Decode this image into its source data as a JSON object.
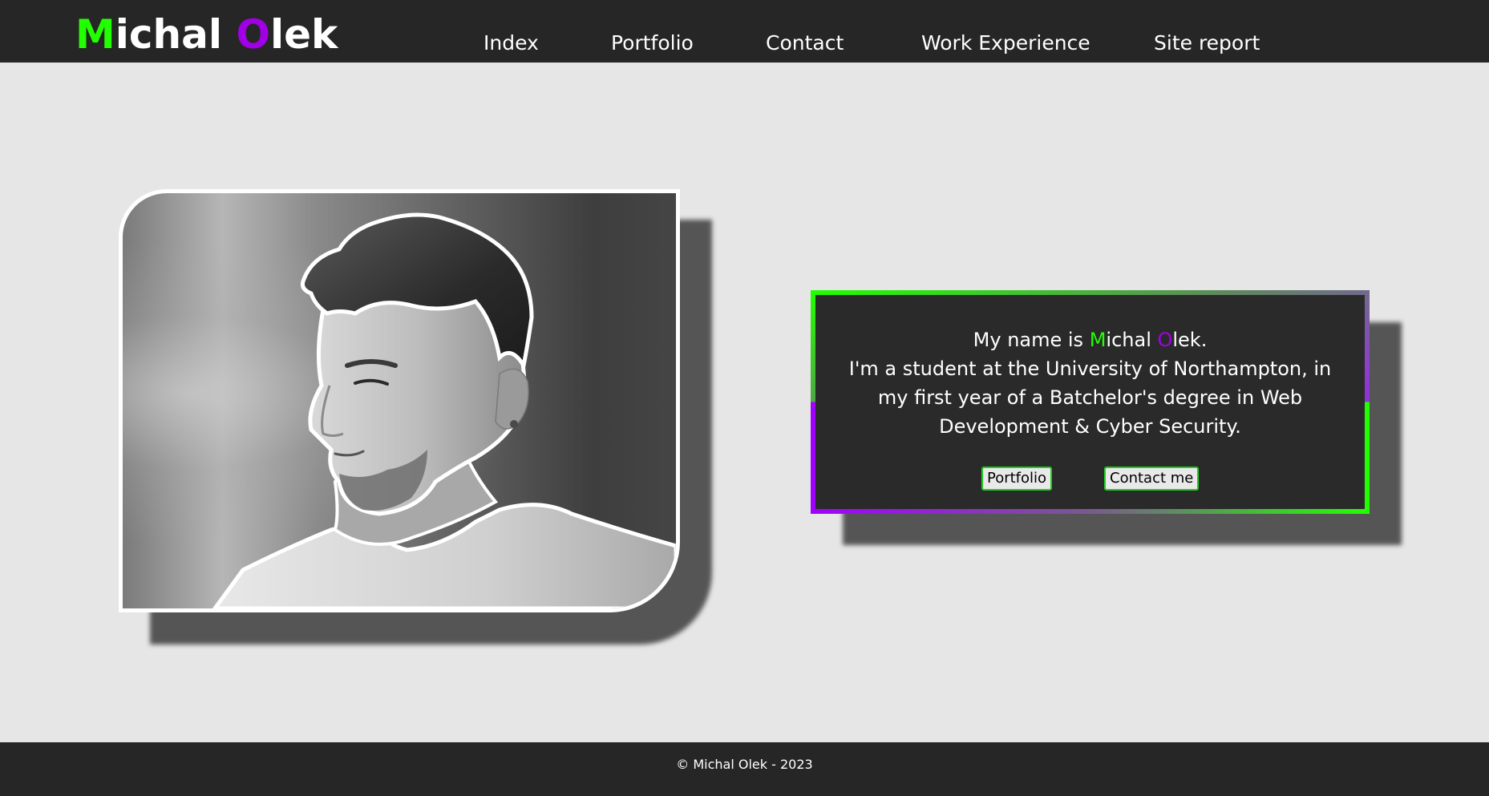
{
  "header": {
    "logo": {
      "first_initial": "M",
      "first_rest": "ichal ",
      "last_initial": "O",
      "last_rest": "lek"
    },
    "nav": [
      {
        "label": "Index"
      },
      {
        "label": "Portfolio"
      },
      {
        "label": "Contact"
      },
      {
        "label": "Work Experience"
      },
      {
        "label": "Site report"
      }
    ]
  },
  "intro": {
    "line1_prefix": "My name is ",
    "name_first_initial": "M",
    "name_first_rest": "ichal ",
    "name_last_initial": "O",
    "name_last_rest": "lek.",
    "line2": "I'm a student at the University of Northampton, in my first year of a Batchelor's degree in Web Development & Cyber Security.",
    "buttons": {
      "portfolio": "Portfolio",
      "contact": "Contact me"
    }
  },
  "footer": {
    "copyright": "© Michal Olek - 2023"
  },
  "colors": {
    "accent_green": "#22ff00",
    "accent_purple": "#a100e6",
    "header_bg": "#262626",
    "page_bg": "#e6e6e6",
    "card_bg": "#2a2a2a"
  },
  "icons": {
    "portrait": "profile-photo"
  }
}
